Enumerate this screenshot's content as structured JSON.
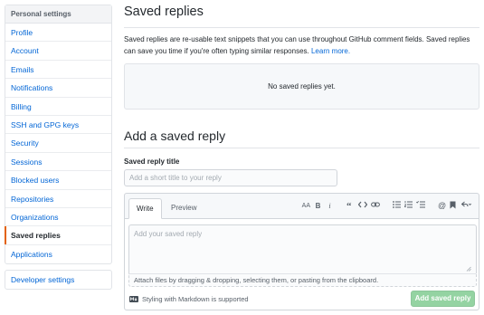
{
  "sidebar": {
    "header": "Personal settings",
    "items": [
      {
        "label": "Profile"
      },
      {
        "label": "Account"
      },
      {
        "label": "Emails"
      },
      {
        "label": "Notifications"
      },
      {
        "label": "Billing"
      },
      {
        "label": "SSH and GPG keys"
      },
      {
        "label": "Security"
      },
      {
        "label": "Sessions"
      },
      {
        "label": "Blocked users"
      },
      {
        "label": "Repositories"
      },
      {
        "label": "Organizations"
      },
      {
        "label": "Saved replies",
        "active": true
      },
      {
        "label": "Applications"
      }
    ],
    "developer": "Developer settings"
  },
  "main": {
    "title": "Saved replies",
    "description": "Saved replies are re-usable text snippets that you can use throughout GitHub comment fields. Saved replies can save you time if you're often typing similar responses.",
    "learn_more": "Learn more.",
    "empty_state": "No saved replies yet.",
    "add_title": "Add a saved reply",
    "field_label": "Saved reply title",
    "field_placeholder": "Add a short title to your reply",
    "tabs": {
      "write": "Write",
      "preview": "Preview"
    },
    "toolbar": {
      "header": "AA",
      "bold": "B",
      "italic": "i"
    },
    "body_placeholder": "Add your saved reply",
    "attach_text": "Attach files by dragging & dropping, selecting them, or pasting from the clipboard.",
    "markdown_note": "Styling with Markdown is supported",
    "submit_label": "Add saved reply"
  },
  "colors": {
    "link": "#0366d6",
    "active_marker": "#e36209",
    "submit_disabled": "#94d3a2"
  }
}
